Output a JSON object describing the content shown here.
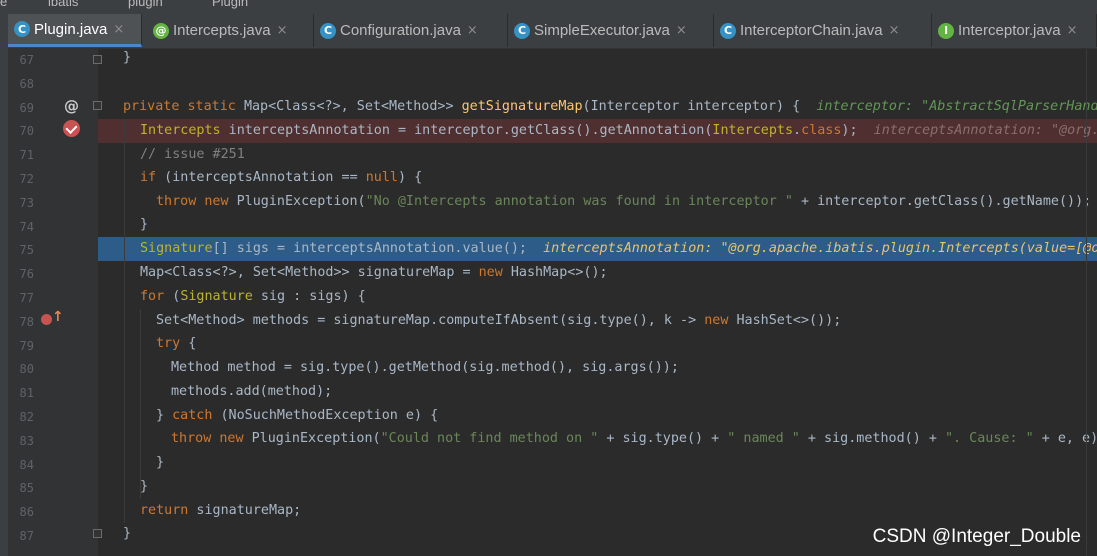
{
  "breadcrumb": [
    "e",
    "ibatis",
    "plugin",
    "Plugin"
  ],
  "tabs": [
    {
      "label": "Plugin.java",
      "icon": "class-icon",
      "active": true
    },
    {
      "label": "Intercepts.java",
      "icon": "annotation-icon",
      "active": false
    },
    {
      "label": "Configuration.java",
      "icon": "class-icon",
      "active": false
    },
    {
      "label": "SimpleExecutor.java",
      "icon": "class-icon",
      "active": false
    },
    {
      "label": "InterceptorChain.java",
      "icon": "class-icon",
      "active": false
    },
    {
      "label": "Interceptor.java",
      "icon": "interface-icon",
      "active": false
    }
  ],
  "tab_close_glyph": "×",
  "gutter": {
    "line_numbers": [
      "67",
      "68",
      "69",
      "70",
      "71",
      "72",
      "73",
      "74",
      "75",
      "76",
      "77",
      "78",
      "79",
      "80",
      "81",
      "82",
      "83",
      "84",
      "85",
      "86",
      "87"
    ],
    "override_marker": "@",
    "breakpoint_line": "70",
    "current_line": "75"
  },
  "code": {
    "l67": "}",
    "l69_kw": "private static ",
    "l69_type": "Map<Class<?>, Set<Method>> ",
    "l69_fn": "getSignatureMap",
    "l69_rest": "(Interceptor interceptor) {",
    "l69_hint": "interceptor: \"AbstractSqlParserHandl",
    "l70_ann": "Intercepts",
    "l70_a": " interceptsAnnotation = interceptor.getClass().getAnnotation(",
    "l70_ann2": "Intercepts",
    "l70_b": ".",
    "l70_kw": "class",
    "l70_c": ");",
    "l70_hint": "interceptsAnnotation: \"@org.a",
    "l71": "// issue #251",
    "l72_kw": "if",
    "l72_a": " (interceptsAnnotation == ",
    "l72_kw2": "null",
    "l72_b": ") {",
    "l73_kw": "throw new ",
    "l73_a": "PluginException(",
    "l73_str": "\"No @Intercepts annotation was found in interceptor \"",
    "l73_b": " + interceptor.getClass().getName());",
    "l74": "}",
    "l75_ann": "Signature",
    "l75_a": "[] sigs = interceptsAnnotation.value();",
    "l75_hint": "interceptsAnnotation: \"@org.apache.ibatis.plugin.Intercepts(value=[@or",
    "l76_a": "Map<Class<?>, Set<Method>> signatureMap = ",
    "l76_kw": "new ",
    "l76_b": "HashMap<>();",
    "l77_kw": "for",
    "l77_a": " (",
    "l77_ann": "Signature",
    "l77_b": " sig : sigs) {",
    "l78_a": "Set<Method> methods = signatureMap.computeIfAbsent(sig.type(), k -> ",
    "l78_kw": "new ",
    "l78_b": "HashSet<>());",
    "l79_kw": "try",
    "l79_a": " {",
    "l80": "Method method = sig.type().getMethod(sig.method(), sig.args());",
    "l81": "methods.add(method);",
    "l82_a": "} ",
    "l82_kw": "catch",
    "l82_b": " (NoSuchMethodException e) {",
    "l83_kw": "throw new ",
    "l83_a": "PluginException(",
    "l83_str1": "\"Could not find method on \"",
    "l83_b": " + sig.type() + ",
    "l83_str2": "\" named \"",
    "l83_c": " + sig.method() + ",
    "l83_str3": "\". Cause: \"",
    "l83_d": " + e, e);",
    "l84": "}",
    "l85": "}",
    "l86_kw": "return",
    "l86_a": " signatureMap;",
    "l87": "}"
  },
  "watermark": "CSDN @Integer_Double",
  "colors": {
    "background": "#2b2b2b",
    "keyword": "#cc7832",
    "method": "#ffc66d",
    "string": "#6a8759",
    "annotation": "#bbb529",
    "current_line": "#2d5c88",
    "breakpoint_line": "#4f2f2f"
  }
}
